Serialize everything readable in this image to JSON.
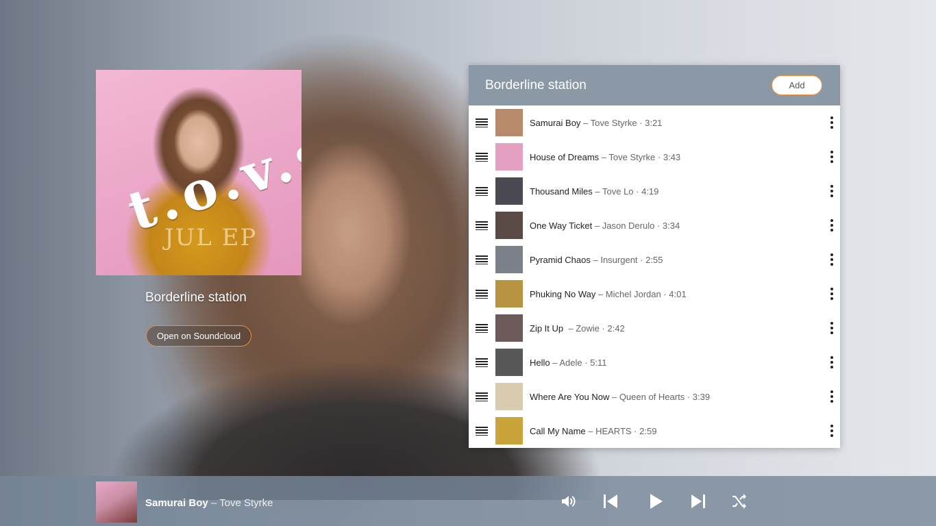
{
  "station": {
    "title": "Borderline station",
    "open_button_label": "Open on Soundcloud",
    "album_logo": "t.o.v.s",
    "album_ep": "JUL EP"
  },
  "playlist": {
    "title": "Borderline station",
    "add_label": "Add",
    "tracks": [
      {
        "name": "Samurai Boy",
        "details": " – Tove Styrke · 3:21",
        "thumb_color": "#b68a6a"
      },
      {
        "name": "House of Dreams",
        "details": " – Tove Styrke · 3:43",
        "thumb_color": "#e4a0c0"
      },
      {
        "name": "Thousand Miles",
        "details": " – Tove Lo · 4:19",
        "thumb_color": "#4b4a52"
      },
      {
        "name": "One Way Ticket",
        "details": " – Jason Derulo · 3:34",
        "thumb_color": "#5a4a45"
      },
      {
        "name": "Pyramid Chaos",
        "details": " – Insurgent · 2:55",
        "thumb_color": "#7c8088"
      },
      {
        "name": "Phuking No Way",
        "details": " – Michel Jordan · 4:01",
        "thumb_color": "#b89442"
      },
      {
        "name": "Zip It Up",
        "details": "  – Zowie · 2:42",
        "thumb_color": "#6e5a5a"
      },
      {
        "name": "Hello",
        "details": " – Adele · 5:11",
        "thumb_color": "#575757"
      },
      {
        "name": "Where Are You Now",
        "details": " – Queen of Hearts · 3:39",
        "thumb_color": "#d8cbb0"
      },
      {
        "name": "Call My Name",
        "details": " – HEARTS · 2:59",
        "thumb_color": "#c9a43a"
      }
    ]
  },
  "now_playing": {
    "title": "Samurai Boy",
    "artist": " – Tove Styrke"
  },
  "controls": {
    "icons": [
      "volume-icon",
      "previous-icon",
      "play-icon",
      "next-icon",
      "shuffle-icon"
    ]
  }
}
